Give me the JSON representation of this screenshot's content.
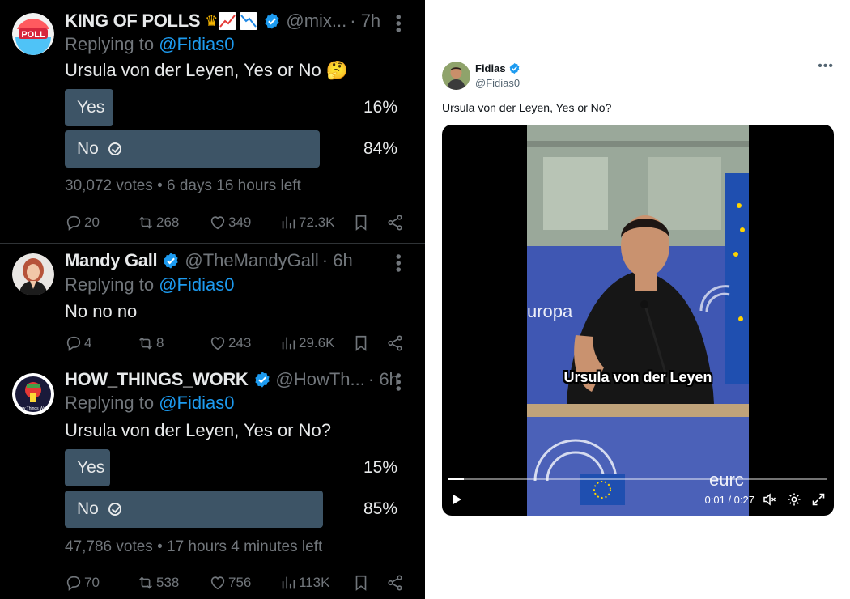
{
  "left_feed": {
    "posts": [
      {
        "avatar_text": "POLL",
        "name": "KING OF POLLS",
        "handle": "@mix...",
        "time": "· 7h",
        "replying_prefix": "Replying to",
        "replying_to": "@Fidias0",
        "text": "Ursula von der Leyen, Yes or No 🤔",
        "poll": [
          {
            "label": "Yes",
            "pct": "16%",
            "fraction": 0.16
          },
          {
            "label": "No",
            "pct": "84%",
            "fraction": 0.84,
            "winner": true
          }
        ],
        "meta": "30,072 votes • 6 days 16 hours left",
        "replies": "20",
        "reposts": "268",
        "likes": "349",
        "views": "72.3K"
      },
      {
        "name": "Mandy Gall",
        "handle": "@TheMandyGall",
        "time": "· 6h",
        "replying_prefix": "Replying to",
        "replying_to": "@Fidias0",
        "text": "No no no",
        "replies": "4",
        "reposts": "8",
        "likes": "243",
        "views": "29.6K"
      },
      {
        "name": "HOW_THINGS_WORK",
        "handle": "@HowTh...",
        "time": "· 6h",
        "avatar_text": "How Things Work",
        "replying_prefix": "Replying to",
        "replying_to": "@Fidias0",
        "text": "Ursula von der Leyen, Yes or No?",
        "poll": [
          {
            "label": "Yes",
            "pct": "15%",
            "fraction": 0.15
          },
          {
            "label": "No",
            "pct": "85%",
            "fraction": 0.85,
            "winner": true
          }
        ],
        "meta": "47,786 votes • 17 hours 4 minutes left",
        "replies": "70",
        "reposts": "538",
        "likes": "756",
        "views": "113K"
      }
    ]
  },
  "right_post": {
    "name": "Fidias",
    "handle": "@Fidias0",
    "text": "Ursula von der Leyen, Yes or No?",
    "video": {
      "caption": "Ursula von der Leyen",
      "time": "0:01 / 0:27",
      "progress": 0.04,
      "bg_text_1": "uropa",
      "bg_text_2": "eurc"
    }
  },
  "colors": {
    "dark_bg": "#000000",
    "poll_fill": "#3d5466",
    "accent_blue": "#1d9bf0",
    "muted_gray": "#71767b"
  }
}
